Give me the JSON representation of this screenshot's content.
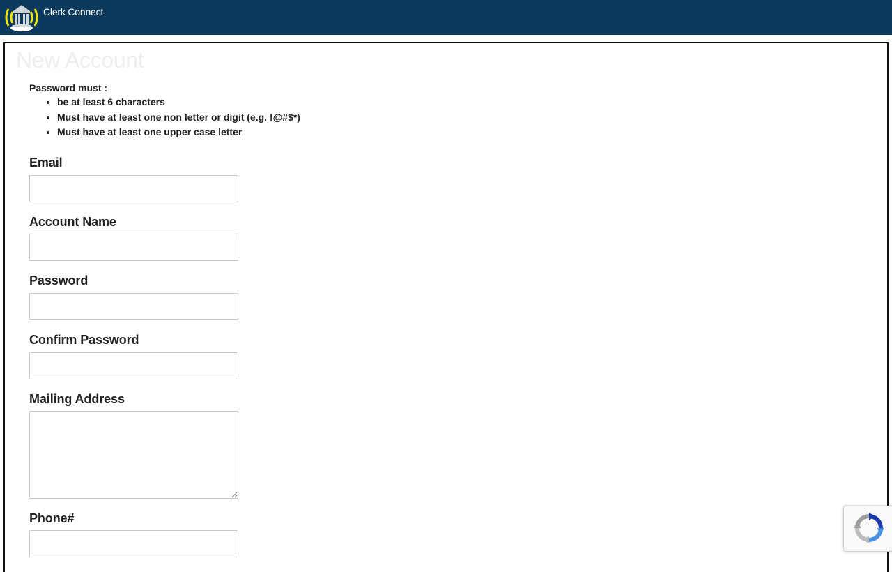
{
  "app": {
    "title": "Clerk Connect"
  },
  "page": {
    "title": "New Account"
  },
  "password_rules": {
    "heading": "Password must :",
    "items": [
      "be at least 6 characters",
      "Must have at least one non letter or digit (e.g. !@#$*)",
      "Must have at least one upper case letter"
    ]
  },
  "form": {
    "email": {
      "label": "Email",
      "value": "",
      "placeholder": ""
    },
    "account_name": {
      "label": "Account Name",
      "value": "",
      "placeholder": ""
    },
    "password": {
      "label": "Password",
      "value": "",
      "placeholder": ""
    },
    "confirm_password": {
      "label": "Confirm Password",
      "value": "",
      "placeholder": ""
    },
    "mailing_address": {
      "label": "Mailing Address",
      "value": "",
      "placeholder": ""
    },
    "phone": {
      "label": "Phone#",
      "value": "",
      "placeholder": ""
    }
  },
  "icons": {
    "logo": "courthouse-signal-icon",
    "captcha": "recaptcha-icon"
  },
  "colors": {
    "header_bg": "#0b3a5c",
    "logo_accent": "#f2e500",
    "title_text": "#eeeeee"
  }
}
